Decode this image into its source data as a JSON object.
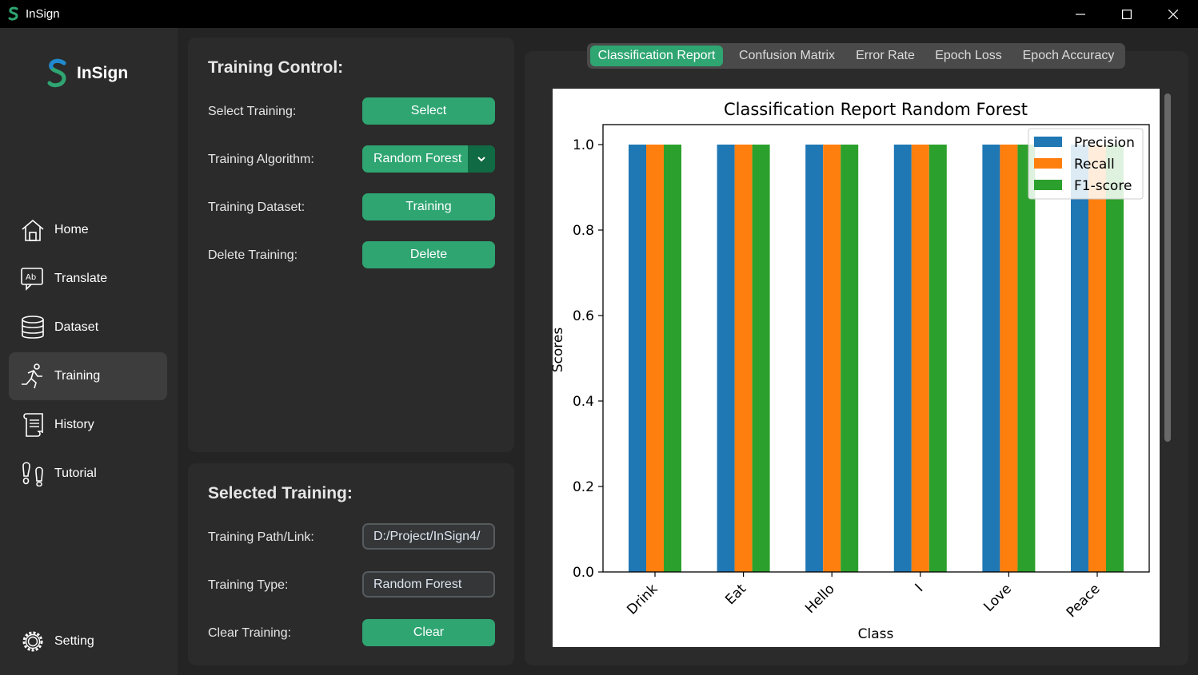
{
  "window": {
    "title": "InSign",
    "minimize": "—",
    "maximize": "☐",
    "close": "✕"
  },
  "sidebar": {
    "logo_text": "InSign",
    "items": [
      {
        "label": "Home",
        "icon": "home-icon"
      },
      {
        "label": "Translate",
        "icon": "translate-icon"
      },
      {
        "label": "Dataset",
        "icon": "database-icon"
      },
      {
        "label": "Training",
        "icon": "running-person-icon",
        "active": true
      },
      {
        "label": "History",
        "icon": "scroll-icon"
      },
      {
        "label": "Tutorial",
        "icon": "footprints-icon"
      }
    ],
    "settings_label": "Setting"
  },
  "training_control": {
    "title": "Training Control:",
    "select_label": "Select Training:",
    "select_button": "Select",
    "algorithm_label": "Training Algorithm:",
    "algorithm_value": "Random Forest",
    "dataset_label": "Training Dataset:",
    "dataset_button": "Training",
    "delete_label": "Delete Training:",
    "delete_button": "Delete"
  },
  "selected_training": {
    "title": "Selected Training:",
    "path_label": "Training Path/Link:",
    "path_value": "D:/Project/InSign4/",
    "type_label": "Training Type:",
    "type_value": "Random Forest",
    "clear_label": "Clear Training:",
    "clear_button": "Clear"
  },
  "tabs": [
    "Classification Report",
    "Confusion Matrix",
    "Error Rate",
    "Epoch Loss",
    "Epoch Accuracy"
  ],
  "colors": {
    "accent": "#2fa572",
    "accent_dark": "#106a43",
    "precision": "#1f77b4",
    "recall": "#ff7f0e",
    "f1": "#2ca02c"
  },
  "chart_data": {
    "type": "bar",
    "title": "Classification Report Random Forest",
    "xlabel": "Class",
    "ylabel": "Scores",
    "categories": [
      "Drink",
      "Eat",
      "Hello",
      "I",
      "Love",
      "Peace"
    ],
    "series": [
      {
        "name": "Precision",
        "values": [
          1.0,
          1.0,
          1.0,
          1.0,
          1.0,
          1.0
        ],
        "color": "#1f77b4"
      },
      {
        "name": "Recall",
        "values": [
          1.0,
          1.0,
          1.0,
          1.0,
          1.0,
          1.0
        ],
        "color": "#ff7f0e"
      },
      {
        "name": "F1-score",
        "values": [
          1.0,
          1.0,
          1.0,
          1.0,
          1.0,
          1.0
        ],
        "color": "#2ca02c"
      }
    ],
    "ylim": [
      0,
      1.05
    ],
    "yticks": [
      "0.0",
      "0.2",
      "0.4",
      "0.6",
      "0.8",
      "1.0"
    ],
    "legend": "top-right",
    "grid": false
  }
}
